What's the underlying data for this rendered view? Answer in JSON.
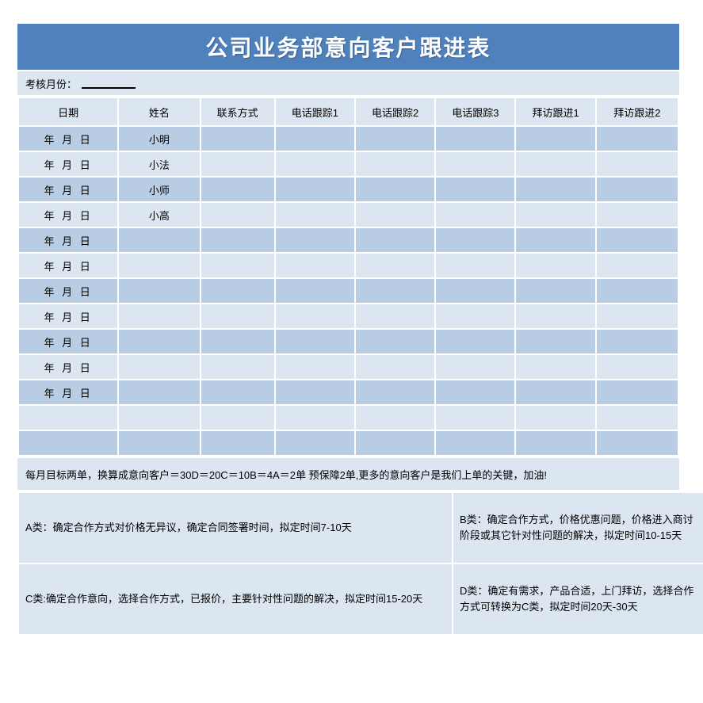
{
  "document": {
    "title": "公司业务部意向客户跟进表",
    "month_field": {
      "label": "考核月份：",
      "value": ""
    }
  },
  "table": {
    "columns": [
      "日期",
      "姓名",
      "联系方式",
      "电话跟踪1",
      "电话跟踪2",
      "电话跟踪3",
      "拜访跟进1",
      "拜访跟进2"
    ],
    "rows": [
      {
        "date": "年 月 日",
        "name": "小明",
        "contact": "",
        "call1": "",
        "call2": "",
        "call3": "",
        "visit1": "",
        "visit2": ""
      },
      {
        "date": "年 月 日",
        "name": "小法",
        "contact": "",
        "call1": "",
        "call2": "",
        "call3": "",
        "visit1": "",
        "visit2": ""
      },
      {
        "date": "年 月 日",
        "name": "小师",
        "contact": "",
        "call1": "",
        "call2": "",
        "call3": "",
        "visit1": "",
        "visit2": ""
      },
      {
        "date": "年 月 日",
        "name": "小高",
        "contact": "",
        "call1": "",
        "call2": "",
        "call3": "",
        "visit1": "",
        "visit2": ""
      },
      {
        "date": "年 月 日",
        "name": "",
        "contact": "",
        "call1": "",
        "call2": "",
        "call3": "",
        "visit1": "",
        "visit2": ""
      },
      {
        "date": "年 月 日",
        "name": "",
        "contact": "",
        "call1": "",
        "call2": "",
        "call3": "",
        "visit1": "",
        "visit2": ""
      },
      {
        "date": "年 月 日",
        "name": "",
        "contact": "",
        "call1": "",
        "call2": "",
        "call3": "",
        "visit1": "",
        "visit2": ""
      },
      {
        "date": "年 月 日",
        "name": "",
        "contact": "",
        "call1": "",
        "call2": "",
        "call3": "",
        "visit1": "",
        "visit2": ""
      },
      {
        "date": "年 月 日",
        "name": "",
        "contact": "",
        "call1": "",
        "call2": "",
        "call3": "",
        "visit1": "",
        "visit2": ""
      },
      {
        "date": "年 月 日",
        "name": "",
        "contact": "",
        "call1": "",
        "call2": "",
        "call3": "",
        "visit1": "",
        "visit2": ""
      },
      {
        "date": "年 月 日",
        "name": "",
        "contact": "",
        "call1": "",
        "call2": "",
        "call3": "",
        "visit1": "",
        "visit2": ""
      },
      {
        "date": "",
        "name": "",
        "contact": "",
        "call1": "",
        "call2": "",
        "call3": "",
        "visit1": "",
        "visit2": ""
      },
      {
        "date": "",
        "name": "",
        "contact": "",
        "call1": "",
        "call2": "",
        "call3": "",
        "visit1": "",
        "visit2": ""
      }
    ]
  },
  "note": {
    "text": "每月目标两单，换算成意向客户＝30D＝20C＝10B＝4A＝2单 预保障2单,更多的意向客户是我们上单的关键，加油!"
  },
  "categories": {
    "a": "A类：确定合作方式对价格无异议，确定合同签署时间，拟定时间7-10天",
    "b": "B类：确定合作方式，价格优惠问题，价格进入商讨阶段或其它针对性问题的解决，拟定时间10-15天",
    "c": "C类:确定合作意向，选择合作方式，已报价，主要针对性问题的解决，拟定时间15-20天",
    "d": "D类：确定有需求，产品合适，上门拜访，选择合作方式可转换为C类，拟定时间20天-30天"
  },
  "colors": {
    "banner": "#4f81bd",
    "row_dark": "#b8cce4",
    "row_light": "#dce6f1",
    "page": "#ffffff"
  }
}
